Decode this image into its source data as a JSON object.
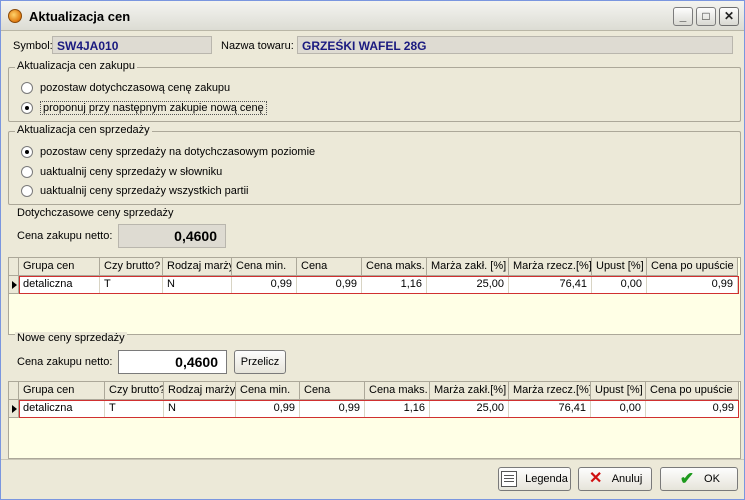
{
  "window": {
    "title": "Aktualizacja cen",
    "buttons": {
      "minimize": "_",
      "maximize": "□",
      "close": "✕"
    }
  },
  "header": {
    "symbol_label": "Symbol:",
    "symbol_value": "SW4JA010",
    "name_label": "Nazwa towaru:",
    "name_value": "GRZEŚKI WAFEL 28G"
  },
  "purchase_group": {
    "title": "Aktualizacja cen zakupu",
    "options": [
      {
        "label": "pozostaw dotychczasową cenę zakupu",
        "selected": false
      },
      {
        "label": "proponuj przy następnym zakupie nową cenę",
        "selected": true
      }
    ]
  },
  "sales_group": {
    "title": "Aktualizacja cen sprzedaży",
    "options": [
      {
        "label": "pozostaw ceny sprzedaży na dotychczasowym poziomie",
        "selected": true
      },
      {
        "label": "uaktualnij ceny sprzedaży w słowniku",
        "selected": false
      },
      {
        "label": "uaktualnij ceny sprzedaży wszystkich partii",
        "selected": false
      }
    ]
  },
  "current_prices": {
    "title": "Dotychczasowe ceny sprzedaży",
    "net_label": "Cena zakupu netto:",
    "net_value": "0,4600",
    "columns": [
      "Grupa cen",
      "Czy brutto?",
      "Rodzaj marży",
      "Cena min.",
      "Cena",
      "Cena maks.",
      "Marża zakł. [%]",
      "Marża rzecz.[%]",
      "Upust [%]",
      "Cena po upuście"
    ],
    "rows": [
      [
        "detaliczna",
        "T",
        "N",
        "0,99",
        "0,99",
        "1,16",
        "25,00",
        "76,41",
        "0,00",
        "0,99"
      ]
    ]
  },
  "new_prices": {
    "title": "Nowe ceny sprzedaży",
    "net_label": "Cena zakupu netto:",
    "net_value": "0,4600",
    "recalc_button": "Przelicz",
    "columns": [
      "Grupa cen",
      "Czy brutto?",
      "Rodzaj marży",
      "Cena min.",
      "Cena",
      "Cena maks.",
      "Marża zakł.[%]",
      "Marża rzecz.[%]",
      "Upust [%]",
      "Cena po upuście"
    ],
    "rows": [
      [
        "detaliczna",
        "T",
        "N",
        "0,99",
        "0,99",
        "1,16",
        "25,00",
        "76,41",
        "0,00",
        "0,99"
      ]
    ]
  },
  "footer": {
    "legend_button": "Legenda",
    "cancel_button": "Anuluj",
    "ok_button": "OK"
  }
}
